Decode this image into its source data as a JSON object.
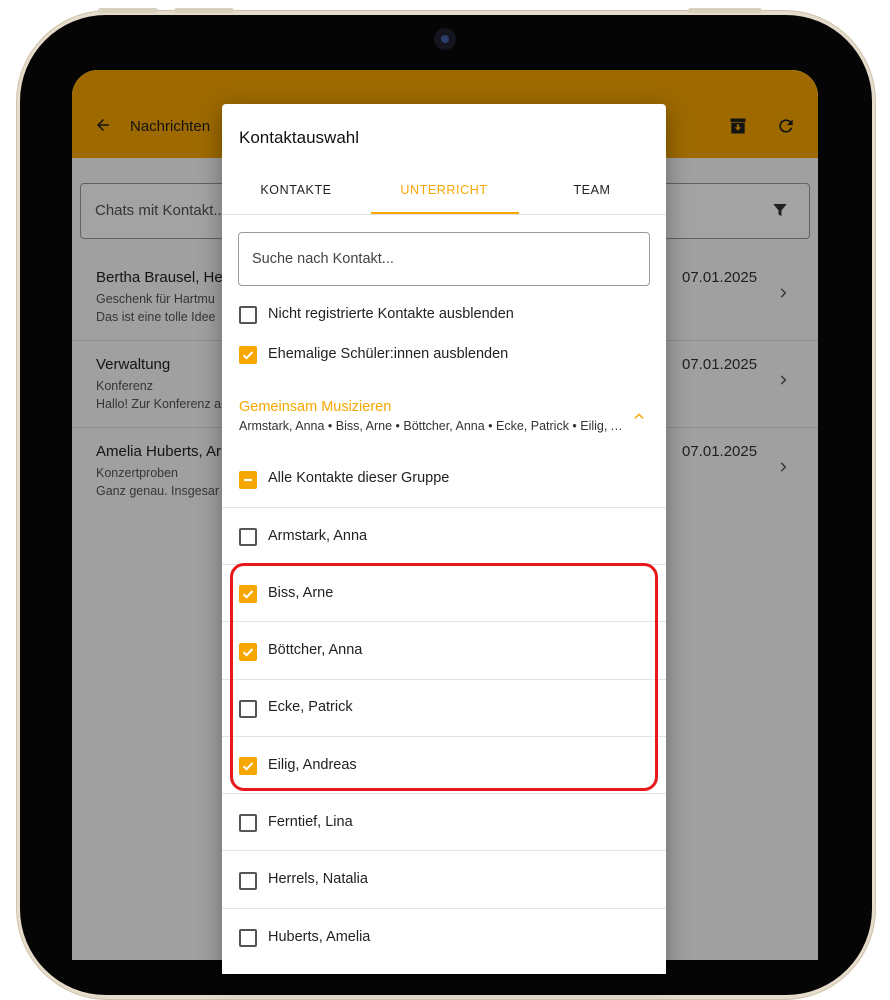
{
  "appbar": {
    "title": "Nachrichten",
    "back_icon": "arrow-left-icon",
    "archive_icon": "archive-icon",
    "refresh_icon": "refresh-icon"
  },
  "chat_search": {
    "placeholder": "Chats mit Kontakt..."
  },
  "chats": [
    {
      "name": "Bertha Brausel, Hei",
      "subject": "Geschenk für Hartmu",
      "preview": "Das ist eine tolle Idee",
      "date": "07.01.2025"
    },
    {
      "name": "Verwaltung",
      "subject": "Konferenz",
      "preview": "Hallo! Zur Konferenz a",
      "date": "07.01.2025"
    },
    {
      "name": "Amelia Huberts, Ar",
      "subject": "Konzertproben",
      "preview": "Ganz genau. Insgesar",
      "date": "07.01.2025"
    }
  ],
  "dialog": {
    "title": "Kontaktauswahl",
    "tabs": [
      {
        "label": "KONTAKTE",
        "active": false
      },
      {
        "label": "UNTERRICHT",
        "active": true
      },
      {
        "label": "TEAM",
        "active": false
      }
    ],
    "search_placeholder": "Suche nach Kontakt...",
    "options": [
      {
        "label": "Nicht registrierte Kontakte ausblenden",
        "checked": false
      },
      {
        "label": "Ehemalige Schüler:innen ausblenden",
        "checked": true
      }
    ],
    "group": {
      "title": "Gemeinsam Musizieren",
      "members": "Armstark, Anna • Biss, Arne • Böttcher, Anna • Ecke, Patrick • Eilig, Andreas",
      "all_label": "Alle Kontakte dieser Gruppe",
      "all_state": "indeterminate"
    },
    "contacts": [
      {
        "name": "Armstark, Anna",
        "checked": false
      },
      {
        "name": "Biss, Arne",
        "checked": true
      },
      {
        "name": "Böttcher, Anna",
        "checked": true
      },
      {
        "name": "Ecke, Patrick",
        "checked": false
      },
      {
        "name": "Eilig, Andreas",
        "checked": true
      },
      {
        "name": "Ferntief, Lina",
        "checked": false
      },
      {
        "name": "Herrels, Natalia",
        "checked": false
      },
      {
        "name": "Huberts, Amelia",
        "checked": false
      }
    ]
  },
  "colors": {
    "accent": "#f8a600",
    "highlight": "#e8191a"
  }
}
